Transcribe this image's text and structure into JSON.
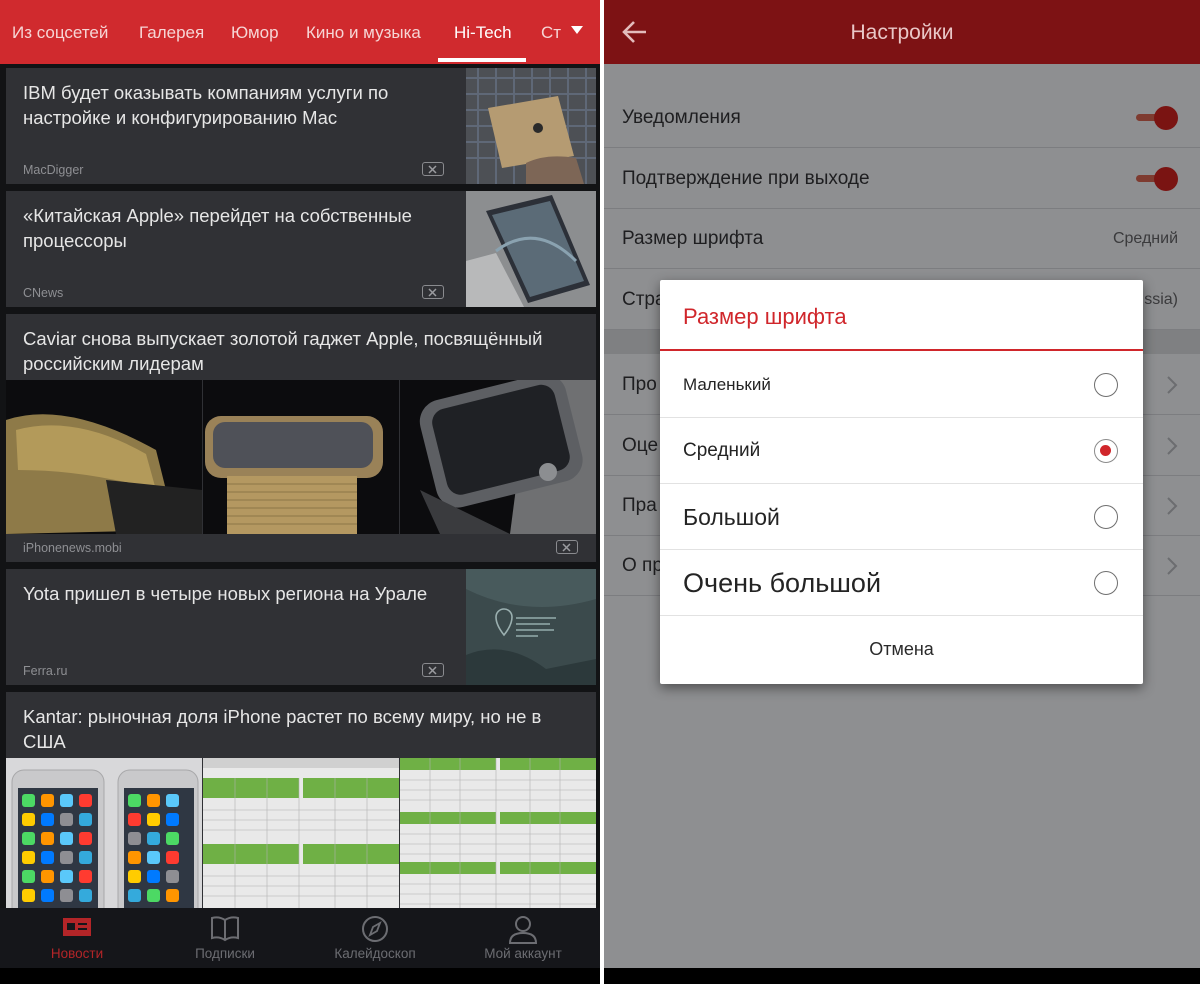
{
  "left": {
    "tabs": [
      "Из соцсетей",
      "Галерея",
      "Юмор",
      "Кино и музыка",
      "Hi-Tech",
      "Ст"
    ],
    "active_tab": "Hi-Tech",
    "articles": [
      {
        "title": "IBM будет оказывать компаниям услуги по настройке и конфигурированию Mac",
        "source": "MacDigger"
      },
      {
        "title": "«Китайская Apple» перейдет на собственные процессоры",
        "source": "CNews"
      },
      {
        "title": "Caviar снова выпускает золотой гаджет Apple, посвящённый российским лидерам",
        "source": "iPhonenews.mobi"
      },
      {
        "title": "Yota пришел в четыре новых региона на Урале",
        "source": "Ferra.ru"
      },
      {
        "title": "Kantar: рыночная доля iPhone растет по всему миру, но не в США",
        "source": ""
      }
    ],
    "bottom_nav": [
      "Новости",
      "Подписки",
      "Калейдоскоп",
      "Мой аккаунт"
    ],
    "active_nav": "Новости",
    "accent": "#d02a2e"
  },
  "right": {
    "title": "Настройки",
    "settings": [
      {
        "label": "Уведомления",
        "type": "toggle",
        "on": true
      },
      {
        "label": "Подтверждение при выходе",
        "type": "toggle",
        "on": true
      },
      {
        "label": "Размер шрифта",
        "type": "value",
        "value": "Средний"
      },
      {
        "label": "Стра",
        "type": "value",
        "value": "ssia)"
      },
      {
        "label": "Про",
        "type": "link"
      },
      {
        "label": "Оце",
        "type": "link"
      },
      {
        "label": "Пра",
        "type": "link"
      },
      {
        "label": "О пр",
        "type": "link"
      }
    ],
    "dialog": {
      "title": "Размер шрифта",
      "options": [
        "Маленький",
        "Средний",
        "Большой",
        "Очень большой"
      ],
      "selected": "Средний",
      "cancel": "Отмена"
    }
  }
}
